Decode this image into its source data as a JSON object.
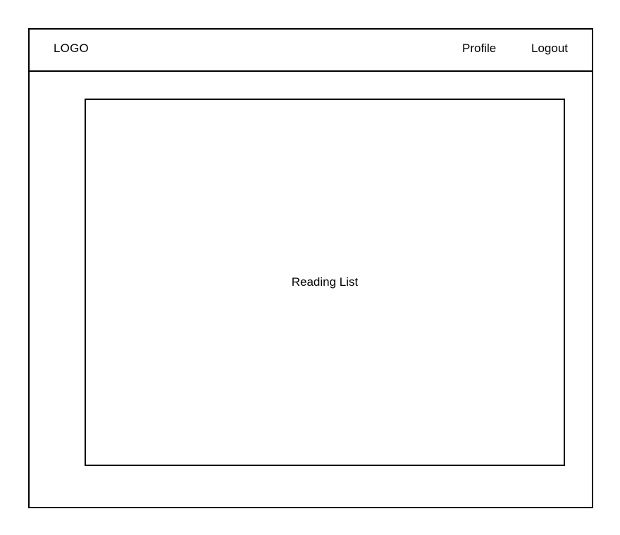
{
  "header": {
    "logo_text": "LOGO",
    "nav": {
      "profile_label": "Profile",
      "logout_label": "Logout"
    }
  },
  "main": {
    "panel_label": "Reading List"
  },
  "colors": {
    "border": "#000000",
    "background": "#ffffff",
    "text": "#000000"
  }
}
